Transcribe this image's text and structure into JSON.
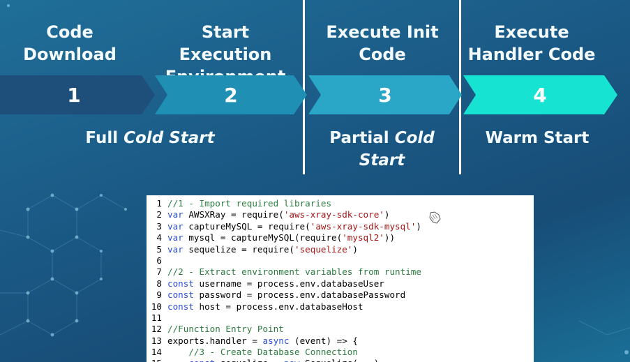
{
  "stages": [
    {
      "title": "Code Download",
      "number": "1"
    },
    {
      "title": "Start Execution Environment",
      "number": "2"
    },
    {
      "title": "Execute Init Code",
      "number": "3"
    },
    {
      "title": "Execute Handler Code",
      "number": "4"
    }
  ],
  "captions": {
    "full_cold_start": {
      "plain": "Full ",
      "italic": "Cold Start"
    },
    "partial_cold_start": {
      "plain": "Partial ",
      "italic": "Cold Start"
    },
    "warm_start": "Warm Start"
  },
  "colors": {
    "chevron_1": "#1e4f7a",
    "chevron_2": "#1f8fb4",
    "chevron_3": "#2aa6c6",
    "chevron_4": "#17e3d3"
  },
  "code": [
    {
      "n": "1",
      "tokens": [
        {
          "t": "cm",
          "v": "//1 - Import required libraries"
        }
      ]
    },
    {
      "n": "2",
      "tokens": [
        {
          "t": "kw",
          "v": "var"
        },
        {
          "t": "tx",
          "v": " AWSXRay = require("
        },
        {
          "t": "str",
          "v": "'aws-xray-sdk-core'"
        },
        {
          "t": "tx",
          "v": ")"
        }
      ]
    },
    {
      "n": "3",
      "tokens": [
        {
          "t": "kw",
          "v": "var"
        },
        {
          "t": "tx",
          "v": " captureMySQL = require("
        },
        {
          "t": "str",
          "v": "'aws-xray-sdk-mysql'"
        },
        {
          "t": "tx",
          "v": ")"
        }
      ]
    },
    {
      "n": "4",
      "tokens": [
        {
          "t": "kw",
          "v": "var"
        },
        {
          "t": "tx",
          "v": " mysql = captureMySQL(require("
        },
        {
          "t": "str",
          "v": "'mysql2'"
        },
        {
          "t": "tx",
          "v": "))"
        }
      ]
    },
    {
      "n": "5",
      "tokens": [
        {
          "t": "kw",
          "v": "var"
        },
        {
          "t": "tx",
          "v": " sequelize = require("
        },
        {
          "t": "str",
          "v": "'sequelize'"
        },
        {
          "t": "tx",
          "v": ")"
        }
      ]
    },
    {
      "n": "6",
      "tokens": []
    },
    {
      "n": "7",
      "tokens": [
        {
          "t": "cm",
          "v": "//2 - Extract environment variables from runtime"
        }
      ]
    },
    {
      "n": "8",
      "tokens": [
        {
          "t": "kw",
          "v": "const"
        },
        {
          "t": "tx",
          "v": " username = process.env.databaseUser"
        }
      ]
    },
    {
      "n": "9",
      "tokens": [
        {
          "t": "kw",
          "v": "const"
        },
        {
          "t": "tx",
          "v": " password = process.env.databasePassword"
        }
      ]
    },
    {
      "n": "10",
      "tokens": [
        {
          "t": "kw",
          "v": "const"
        },
        {
          "t": "tx",
          "v": " host = process.env.databaseHost"
        }
      ]
    },
    {
      "n": "11",
      "tokens": []
    },
    {
      "n": "12",
      "tokens": [
        {
          "t": "cm",
          "v": "//Function Entry Point"
        }
      ]
    },
    {
      "n": "13",
      "tokens": [
        {
          "t": "tx",
          "v": "exports.handler = "
        },
        {
          "t": "kw",
          "v": "async"
        },
        {
          "t": "tx",
          "v": " (event) => {"
        }
      ]
    },
    {
      "n": "14",
      "tokens": [
        {
          "t": "tx",
          "v": "    "
        },
        {
          "t": "cm",
          "v": "//3 - Create Database Connection"
        }
      ]
    },
    {
      "n": "15",
      "tokens": [
        {
          "t": "tx",
          "v": "    "
        },
        {
          "t": "kw",
          "v": "const"
        },
        {
          "t": "tx",
          "v": " sequelize = "
        },
        {
          "t": "kw",
          "v": "new"
        },
        {
          "t": "tx",
          "v": " Sequelize(...)"
        }
      ]
    }
  ]
}
